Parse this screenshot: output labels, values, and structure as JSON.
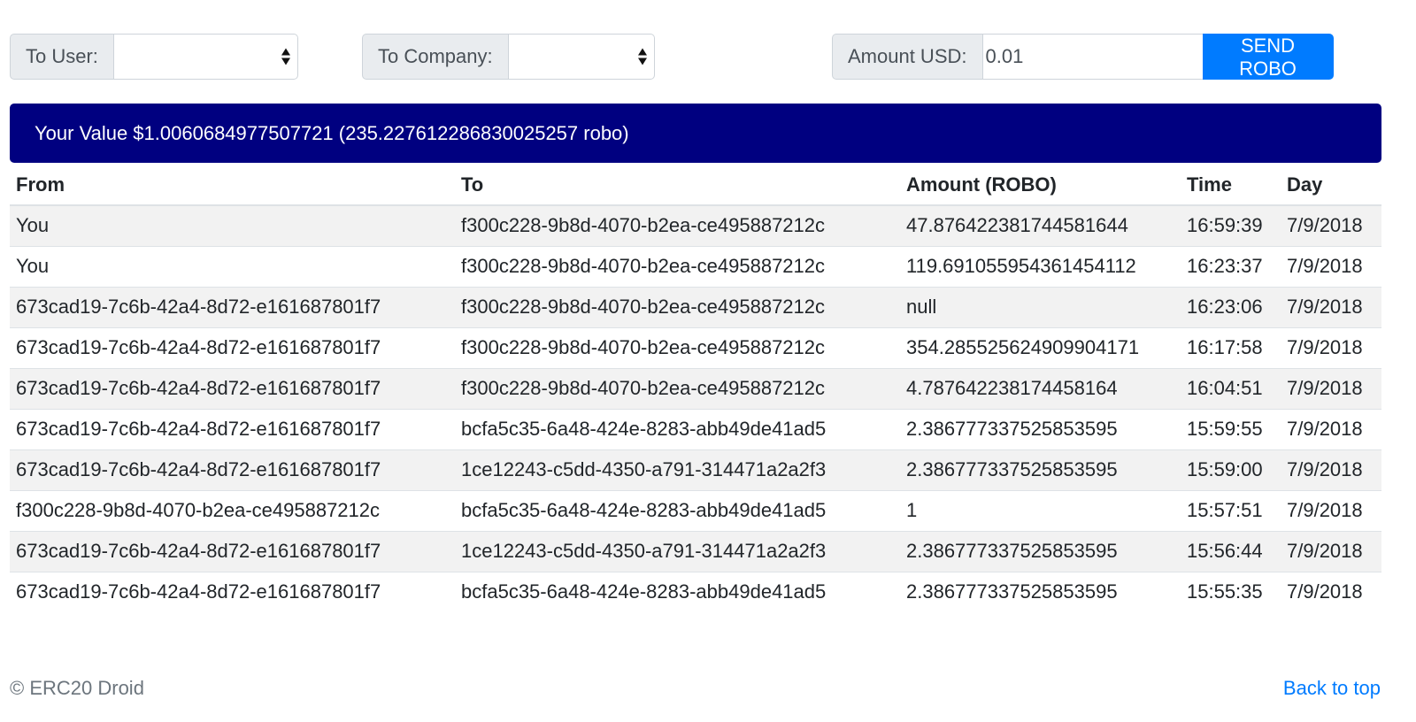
{
  "form": {
    "to_user_label": "To User:",
    "to_user_value": "",
    "to_company_label": "To Company:",
    "to_company_value": "",
    "amount_label": "Amount USD:",
    "amount_value": "0.01",
    "send_button": "SEND ROBO"
  },
  "banner": {
    "text": "Your Value $1.0060684977507721 (235.227612286830025257 robo)"
  },
  "table": {
    "headers": [
      "From",
      "To",
      "Amount (ROBO)",
      "Time",
      "Day"
    ],
    "rows": [
      [
        "You",
        "f300c228-9b8d-4070-b2ea-ce495887212c",
        "47.876422381744581644",
        "16:59:39",
        "7/9/2018"
      ],
      [
        "You",
        "f300c228-9b8d-4070-b2ea-ce495887212c",
        "119.691055954361454112",
        "16:23:37",
        "7/9/2018"
      ],
      [
        "673cad19-7c6b-42a4-8d72-e161687801f7",
        "f300c228-9b8d-4070-b2ea-ce495887212c",
        "null",
        "16:23:06",
        "7/9/2018"
      ],
      [
        "673cad19-7c6b-42a4-8d72-e161687801f7",
        "f300c228-9b8d-4070-b2ea-ce495887212c",
        "354.285525624909904171",
        "16:17:58",
        "7/9/2018"
      ],
      [
        "673cad19-7c6b-42a4-8d72-e161687801f7",
        "f300c228-9b8d-4070-b2ea-ce495887212c",
        "4.787642238174458164",
        "16:04:51",
        "7/9/2018"
      ],
      [
        "673cad19-7c6b-42a4-8d72-e161687801f7",
        "bcfa5c35-6a48-424e-8283-abb49de41ad5",
        "2.386777337525853595",
        "15:59:55",
        "7/9/2018"
      ],
      [
        "673cad19-7c6b-42a4-8d72-e161687801f7",
        "1ce12243-c5dd-4350-a791-314471a2a2f3",
        "2.386777337525853595",
        "15:59:00",
        "7/9/2018"
      ],
      [
        "f300c228-9b8d-4070-b2ea-ce495887212c",
        "bcfa5c35-6a48-424e-8283-abb49de41ad5",
        "1",
        "15:57:51",
        "7/9/2018"
      ],
      [
        "673cad19-7c6b-42a4-8d72-e161687801f7",
        "1ce12243-c5dd-4350-a791-314471a2a2f3",
        "2.386777337525853595",
        "15:56:44",
        "7/9/2018"
      ],
      [
        "673cad19-7c6b-42a4-8d72-e161687801f7",
        "bcfa5c35-6a48-424e-8283-abb49de41ad5",
        "2.386777337525853595",
        "15:55:35",
        "7/9/2018"
      ]
    ]
  },
  "footer": {
    "copyright": "© ERC20 Droid",
    "back_to_top": "Back to top"
  },
  "colors": {
    "banner_bg": "#000080",
    "accent": "#007bff",
    "stripe": "#f2f2f2"
  }
}
